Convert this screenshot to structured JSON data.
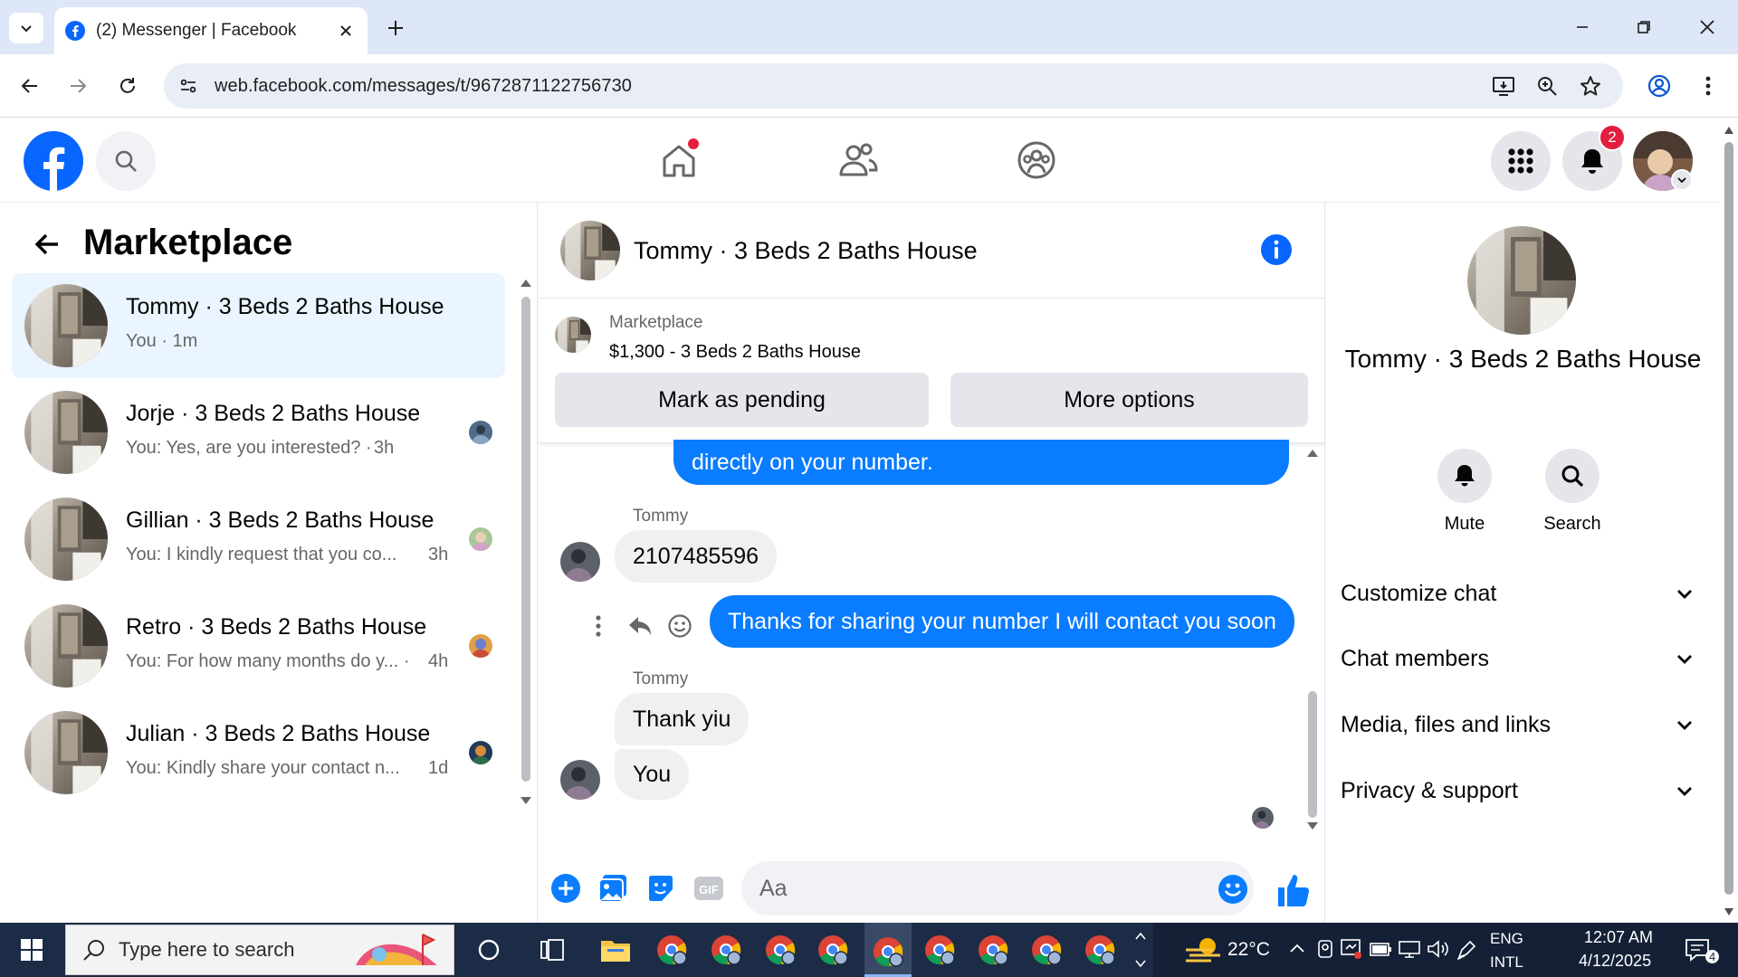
{
  "browser": {
    "tab_title": "(2) Messenger | Facebook",
    "url": "web.facebook.com/messages/t/9672871122756730"
  },
  "fb": {
    "notification_count": "2"
  },
  "left": {
    "title": "Marketplace",
    "conversations": [
      {
        "name": "Tommy · 3 Beds 2 Baths House",
        "snippet": "You · 1m",
        "time": ""
      },
      {
        "name": "Jorje · 3 Beds 2 Baths House",
        "snippet": "You: Yes, are you interested? ·",
        "time": "3h"
      },
      {
        "name": "Gillian · 3 Beds 2 Baths House",
        "snippet": "You: I kindly request that you co...",
        "time": "3h"
      },
      {
        "name": "Retro · 3 Beds 2 Baths House",
        "snippet": "You: For how many months do y... ·",
        "time": "4h"
      },
      {
        "name": "Julian · 3 Beds 2 Baths House",
        "snippet": "You: Kindly share your contact n...",
        "time": "1d"
      }
    ]
  },
  "chat": {
    "title": "Tommy · 3 Beds 2 Baths House",
    "marketplace_label": "Marketplace",
    "listing": "$1,300 - 3 Beds 2 Baths House",
    "mark_pending_label": "Mark as pending",
    "more_options_label": "More options",
    "messages": [
      {
        "sender": "",
        "text": "directly on your number."
      },
      {
        "sender": "Tommy",
        "text": "2107485596"
      },
      {
        "sender": "",
        "text": "Thanks for sharing your number I will contact you soon"
      },
      {
        "sender": "Tommy",
        "text": "Thank yiu"
      },
      {
        "sender": "",
        "text": "You"
      }
    ],
    "input_placeholder": "Aa"
  },
  "right": {
    "name": "Tommy · 3 Beds 2 Baths House",
    "mute_label": "Mute",
    "search_label": "Search",
    "sections": [
      "Customize chat",
      "Chat members",
      "Media, files and links",
      "Privacy & support"
    ]
  },
  "taskbar": {
    "search_placeholder": "Type here to search",
    "weather": "22°C",
    "lang1": "ENG",
    "lang2": "INTL",
    "time": "12:07 AM",
    "date": "4/12/2025",
    "notif_count": "4"
  },
  "colors": {
    "fb_blue": "#0866ff",
    "messenger_blue": "#0a7cff",
    "badge_red": "#e41e3f"
  }
}
